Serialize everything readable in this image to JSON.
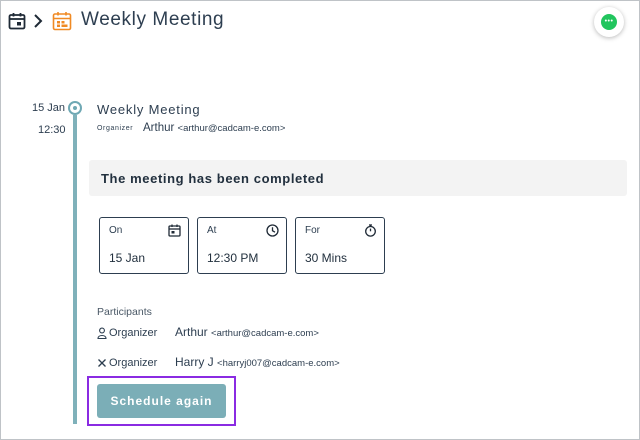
{
  "header": {
    "title": "Weekly Meeting",
    "icons": [
      "calendar-icon",
      "chevron-right-icon",
      "event-calendar-icon",
      "chat-icon"
    ]
  },
  "colors": {
    "accent": "#7baeb7",
    "event_icon": "#f08a24",
    "chat": "#22c55e",
    "highlight": "#8a2be2"
  },
  "timeline": {
    "date": "15 Jan",
    "time": "12:30"
  },
  "event": {
    "title": "Weekly Meeting",
    "organizer_label": "Organizer",
    "organizer_name": "Arthur",
    "organizer_email": "<arthur@cadcam-e.com>"
  },
  "status": {
    "banner": "The meeting has been completed"
  },
  "details": [
    {
      "label": "On",
      "value": "15 Jan",
      "icon": "calendar-icon"
    },
    {
      "label": "At",
      "value": "12:30 PM",
      "icon": "clock-icon"
    },
    {
      "label": "For",
      "value": "30 Mins",
      "icon": "stopwatch-icon"
    }
  ],
  "participants": {
    "heading": "Participants",
    "rows": [
      {
        "role": "Organizer",
        "name": "Arthur",
        "email": "<arthur@cadcam-e.com>",
        "icon": "person-icon"
      },
      {
        "role": "Organizer",
        "name": "Harry J",
        "email": "<harryj007@cadcam-e.com>",
        "icon": "close-icon"
      }
    ]
  },
  "actions": {
    "schedule_again": "Schedule again"
  }
}
